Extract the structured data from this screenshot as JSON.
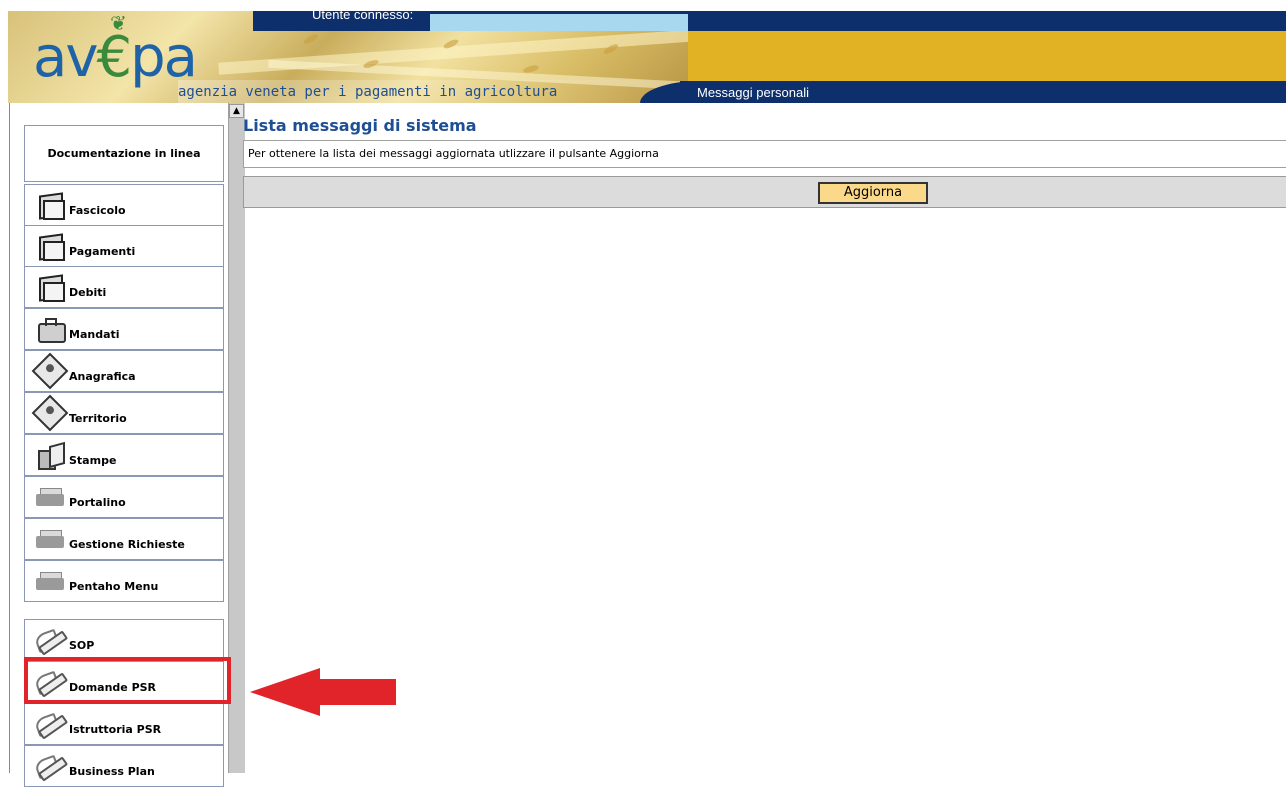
{
  "header": {
    "user_label": "Utente connesso:",
    "logo": "av€pa",
    "tagline": "agenzia veneta per i pagamenti in agricoltura",
    "nav_label": "Messaggi personali"
  },
  "sidebar": {
    "documentation_label": "Documentazione in linea",
    "group1": [
      {
        "label": "Fascicolo",
        "icon": "folder-icon"
      },
      {
        "label": "Pagamenti",
        "icon": "folder-icon"
      },
      {
        "label": "Debiti",
        "icon": "folder-icon"
      },
      {
        "label": "Mandati",
        "icon": "briefcase-icon"
      },
      {
        "label": "Anagrafica",
        "icon": "registry-icon"
      },
      {
        "label": "Territorio",
        "icon": "map-icon"
      },
      {
        "label": "Stampe",
        "icon": "print-icon"
      },
      {
        "label": "Portalino",
        "icon": "tray-icon"
      },
      {
        "label": "Gestione Richieste",
        "icon": "tray-icon"
      },
      {
        "label": "Pentaho Menu",
        "icon": "tray-icon"
      }
    ],
    "group2": [
      {
        "label": "SOP",
        "icon": "pencil-icon"
      },
      {
        "label": "Domande PSR",
        "icon": "pencil-icon"
      },
      {
        "label": "Istruttoria PSR",
        "icon": "pencil-icon"
      },
      {
        "label": "Business Plan",
        "icon": "pencil-icon"
      }
    ]
  },
  "main": {
    "title": "Lista messaggi di sistema",
    "info": "Per ottenere la lista dei messaggi aggiornata utlizzare il pulsante Aggiorna",
    "refresh_button": "Aggiorna"
  },
  "colors": {
    "brand_blue": "#1f4f93",
    "nav_dark": "#0d2f6b",
    "gold": "#e2b225",
    "highlight_red": "#e0242a",
    "button_bg": "#fbd98a"
  }
}
